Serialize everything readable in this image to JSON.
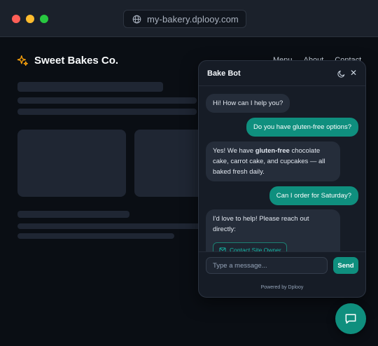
{
  "browser": {
    "url": "my-bakery.dplooy.com"
  },
  "site": {
    "brand": "Sweet Bakes Co.",
    "nav": [
      "Menu",
      "About",
      "Contact"
    ]
  },
  "chat": {
    "title": "Bake Bot",
    "messages": [
      {
        "from": "bot",
        "text": "Hi! How can I help you?"
      },
      {
        "from": "user",
        "text": "Do you have gluten-free options?"
      },
      {
        "from": "bot",
        "text_before": "Yes! We have ",
        "text_bold": "gluten-free",
        "text_after": " chocolate cake, carrot cake, and cupcakes — all baked fresh daily."
      },
      {
        "from": "user",
        "text": "Can I order for Saturday?"
      },
      {
        "from": "bot",
        "text": "I'd love to help! Please reach out directly:"
      }
    ],
    "contact_button": "Contact Site Owner",
    "input_placeholder": "Type a message...",
    "send_label": "Send",
    "powered_by": "Powered by Dplooy"
  },
  "colors": {
    "accent": "#0f8f7e",
    "brand_icon": "#f59e0b"
  },
  "icons": {
    "url": "globe-icon",
    "brand": "sparkles-icon",
    "theme": "moon-icon",
    "close": "close-icon",
    "contact": "mail-icon",
    "launcher": "chat-bubble-icon"
  }
}
